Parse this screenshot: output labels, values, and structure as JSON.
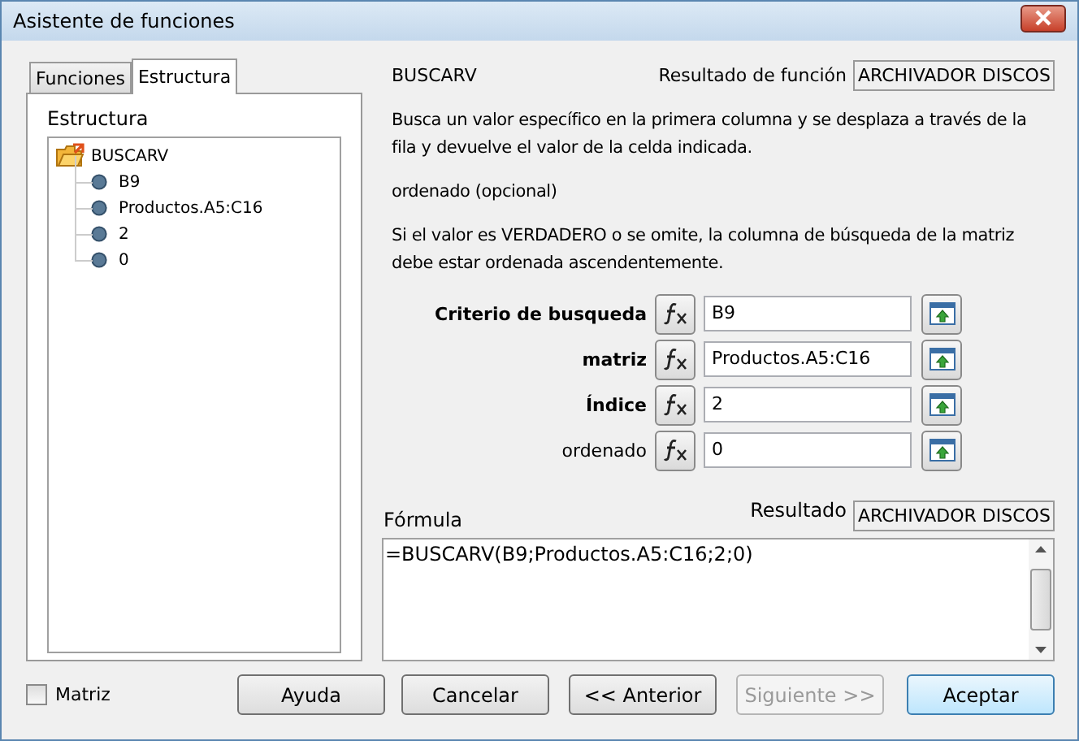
{
  "window": {
    "title": "Asistente de funciones"
  },
  "tabs": [
    {
      "label": "Funciones",
      "selected": false
    },
    {
      "label": "Estructura",
      "selected": true
    }
  ],
  "structure": {
    "label": "Estructura",
    "tree": [
      {
        "label": "BUSCARV",
        "kind": "function",
        "children": [
          {
            "label": "B9",
            "kind": "argument"
          },
          {
            "label": "Productos.A5:C16",
            "kind": "argument"
          },
          {
            "label": "2",
            "kind": "argument"
          },
          {
            "label": "0",
            "kind": "argument"
          }
        ]
      }
    ]
  },
  "function_name": "BUSCARV",
  "function_result": {
    "label": "Resultado de función",
    "value": "ARCHIVADOR DISCOS"
  },
  "description": "Busca un valor específico en la primera columna y se desplaza a través de la fila y devuelve el valor de la celda indicada.",
  "argument_title": "ordenado (opcional)",
  "argument_description": "Si el valor es VERDADERO o se omite, la columna de búsqueda de la matriz debe estar ordenada ascendentemente.",
  "arguments": [
    {
      "label": "Criterio de busqueda",
      "required": true,
      "value": "B9"
    },
    {
      "label": "matriz",
      "required": true,
      "value": "Productos.A5:C16"
    },
    {
      "label": "Índice",
      "required": true,
      "value": "2"
    },
    {
      "label": "ordenado",
      "required": false,
      "value": "0"
    }
  ],
  "formula": {
    "label": "Fórmula",
    "value": "=BUSCARV(B9;Productos.A5:C16;2;0)"
  },
  "result": {
    "label": "Resultado",
    "value": "ARCHIVADOR DISCOS"
  },
  "array_checkbox": {
    "label": "Matriz",
    "checked": false
  },
  "buttons": [
    {
      "label": "Ayuda",
      "disabled": false,
      "default": false
    },
    {
      "label": "Cancelar",
      "disabled": false,
      "default": false
    },
    {
      "label": "<< Anterior",
      "disabled": false,
      "default": false
    },
    {
      "label": "Siguiente >>",
      "disabled": true,
      "default": false
    },
    {
      "label": "Aceptar",
      "disabled": false,
      "default": true
    }
  ]
}
